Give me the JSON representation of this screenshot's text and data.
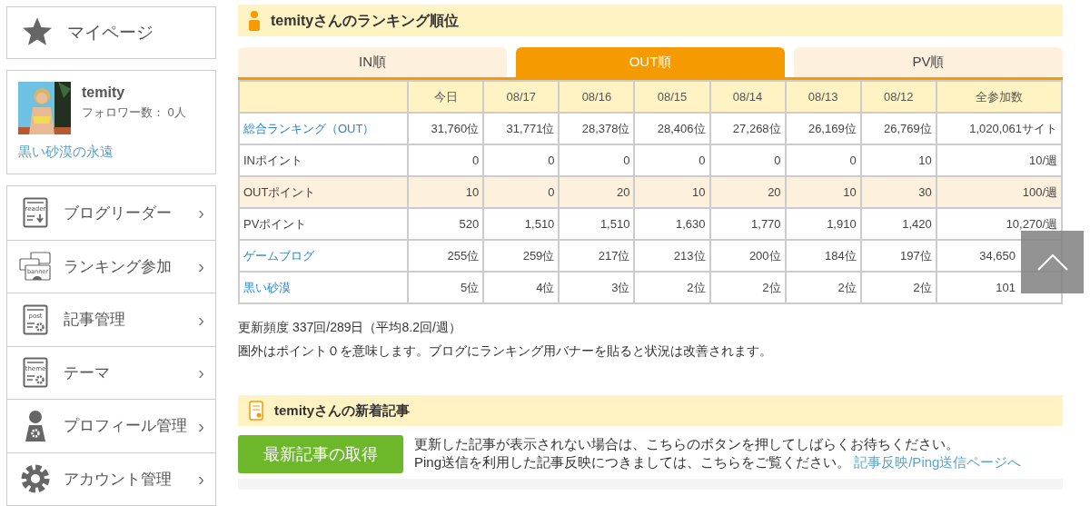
{
  "sidebar": {
    "mypage": {
      "label": "マイページ"
    },
    "profile": {
      "name": "temity",
      "followers": "フォロワー数： 0人",
      "blog_link": "黒い砂漠の永遠"
    },
    "menu": [
      {
        "label": "ブログリーダー",
        "kind": "reader",
        "icon_text": "reader",
        "arrow": "›"
      },
      {
        "label": "ランキング参加",
        "kind": "banner",
        "icon_text": "banner",
        "arrow": "›"
      },
      {
        "label": "記事管理",
        "kind": "doc",
        "icon_text": "post",
        "arrow": "›"
      },
      {
        "label": "テーマ",
        "kind": "doc",
        "icon_text": "theme",
        "arrow": "›"
      },
      {
        "label": "プロフィール管理",
        "kind": "person",
        "arrow": "›"
      },
      {
        "label": "アカウント管理",
        "kind": "gear",
        "arrow": "›"
      }
    ]
  },
  "ranking": {
    "title": "temityさんのランキング順位",
    "tabs": [
      {
        "label": "IN順",
        "selected": false
      },
      {
        "label": "OUT順",
        "selected": true
      },
      {
        "label": "PV順",
        "selected": false
      }
    ],
    "table": {
      "columns": [
        "今日",
        "08/17",
        "08/16",
        "08/15",
        "08/14",
        "08/13",
        "08/12",
        "全参加数"
      ],
      "rows": [
        {
          "label": "総合ランキング（OUT）",
          "link": true,
          "highlighted": false,
          "cells": [
            "31,760位",
            "31,771位",
            "28,378位",
            "28,406位",
            "27,268位",
            "26,169位",
            "26,769位",
            "1,020,061サイト"
          ]
        },
        {
          "label": "INポイント",
          "link": false,
          "highlighted": false,
          "cells": [
            "0",
            "0",
            "0",
            "0",
            "0",
            "0",
            "10",
            "10/週"
          ]
        },
        {
          "label": "OUTポイント",
          "link": false,
          "highlighted": true,
          "cells": [
            "10",
            "0",
            "20",
            "10",
            "20",
            "10",
            "30",
            "100/週"
          ]
        },
        {
          "label": "PVポイント",
          "link": false,
          "highlighted": false,
          "cells": [
            "520",
            "1,510",
            "1,510",
            "1,630",
            "1,770",
            "1,910",
            "1,420",
            "10,270/週"
          ]
        },
        {
          "label": "ゲームブログ",
          "link": true,
          "highlighted": false,
          "cut_by_overlay": true,
          "cells": [
            "255位",
            "259位",
            "217位",
            "213位",
            "200位",
            "184位",
            "197位",
            "34,650"
          ]
        },
        {
          "label": "黒い砂漠",
          "link": true,
          "highlighted": false,
          "cut_by_overlay": true,
          "cells": [
            "5位",
            "4位",
            "3位",
            "2位",
            "2位",
            "2位",
            "2位",
            "101"
          ]
        }
      ]
    },
    "notes": [
      "更新頻度 337回/289日（平均8.2回/週）",
      "圏外はポイント０を意味します。ブログにランキング用バナーを貼ると状況は改善されます。"
    ]
  },
  "articles": {
    "title": "temityさんの新着記事",
    "button": "最新記事の取得",
    "text_1": "更新した記事が表示されない場合は、こちらのボタンを押してしばらくお待ちください。",
    "text_2": "Ping送信を利用した記事反映につきましては、こちらをご覧ください。",
    "link": "記事反映/Ping送信ページへ"
  }
}
